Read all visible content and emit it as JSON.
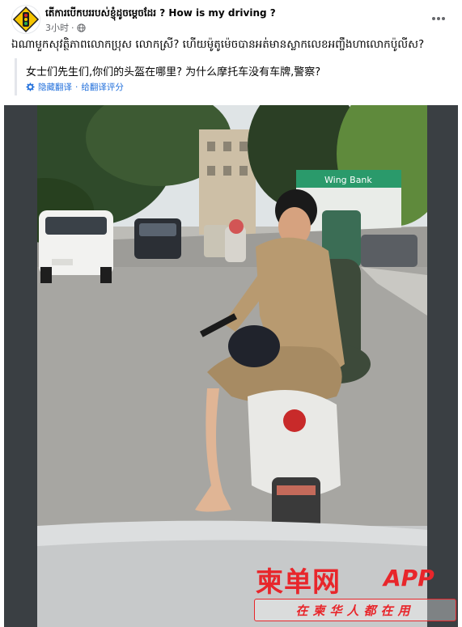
{
  "post": {
    "page_name": "តើការបើកបររបស់ខ្ញុំដូចម្ដេចដែរ ? How is my driving ?",
    "time": "3小时",
    "separator": "·",
    "more_icon": "more-horizontal-icon",
    "text": "ឯណាមួកសុវត្ថិភាពលោកប្រុស លោកស្រី? ហើយម៉ូតូម៉េចបានអត់មានស្លាកលេខអញ្ចឹងហាលោកប៉ូលីស?"
  },
  "translation": {
    "text": "女士们先生们,你们的头盔在哪里? 为什么摩托车没有车牌,警察?",
    "hide_label": "隐藏翻译",
    "dot": "·",
    "rate_label": "给翻译评分",
    "gear_icon": "gear-icon"
  },
  "watermark": {
    "logo": "柬单网",
    "app": "APP",
    "slogan": "在柬华人都在用",
    "color": "#e8262b"
  },
  "photo": {
    "sign_text": "Wing Bank",
    "badge_icon": "traffic-light-icon"
  },
  "colors": {
    "accent": "#216fdb",
    "meta": "#65676b",
    "badge": "#f5c400"
  }
}
